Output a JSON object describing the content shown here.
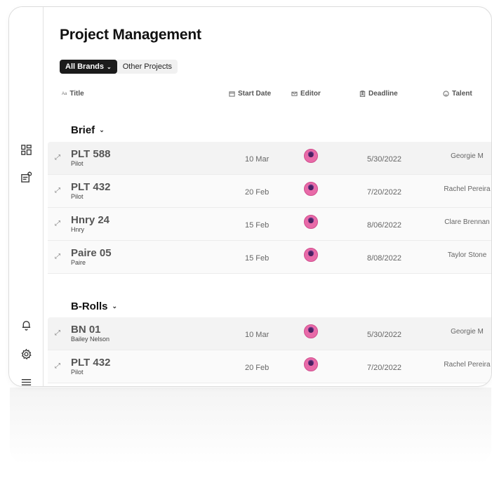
{
  "page": {
    "title": "Project Management"
  },
  "brand_tabs": [
    {
      "label": "All Brands",
      "active": true,
      "chevron": "⌄"
    },
    {
      "label": "Other Projects",
      "active": false
    }
  ],
  "columns": {
    "title": {
      "label": "Title",
      "type_marker": "Aa"
    },
    "start_date": {
      "label": "Start Date",
      "icon": "calendar-icon"
    },
    "editor": {
      "label": "Editor",
      "icon": "mail-icon"
    },
    "deadline": {
      "label": "Deadline",
      "icon": "clipboard-icon"
    },
    "talent": {
      "label": "Talent",
      "icon": "face-icon"
    }
  },
  "groups": [
    {
      "name": "Brief",
      "chevron": "⌄",
      "rows": [
        {
          "title": "PLT 588",
          "subtitle": "Pilot",
          "start_date": "10 Mar",
          "deadline": "5/30/2022",
          "talent": "Georgie M"
        },
        {
          "title": "PLT 432",
          "subtitle": "Pilot",
          "start_date": "20 Feb",
          "deadline": "7/20/2022",
          "talent": "Rachel Pereira"
        },
        {
          "title": "Hnry 24",
          "subtitle": "Hnry",
          "start_date": "15 Feb",
          "deadline": "8/06/2022",
          "talent": "Clare Brennan"
        },
        {
          "title": "Paire 05",
          "subtitle": "Paire",
          "start_date": "15 Feb",
          "deadline": "8/08/2022",
          "talent": "Taylor Stone"
        }
      ]
    },
    {
      "name": "B-Rolls",
      "chevron": "⌄",
      "rows": [
        {
          "title": "BN 01",
          "subtitle": "Bailey Nelson",
          "start_date": "10 Mar",
          "deadline": "5/30/2022",
          "talent": "Georgie M"
        },
        {
          "title": "PLT 432",
          "subtitle": "Pilot",
          "start_date": "20 Feb",
          "deadline": "7/20/2022",
          "talent": "Rachel Pereira"
        }
      ]
    }
  ],
  "row_expand_glyph": "⤢",
  "sidebar": {
    "icons": [
      "dashboard-icon",
      "projects-icon",
      "bell-icon",
      "gear-icon",
      "menu-icon"
    ]
  }
}
